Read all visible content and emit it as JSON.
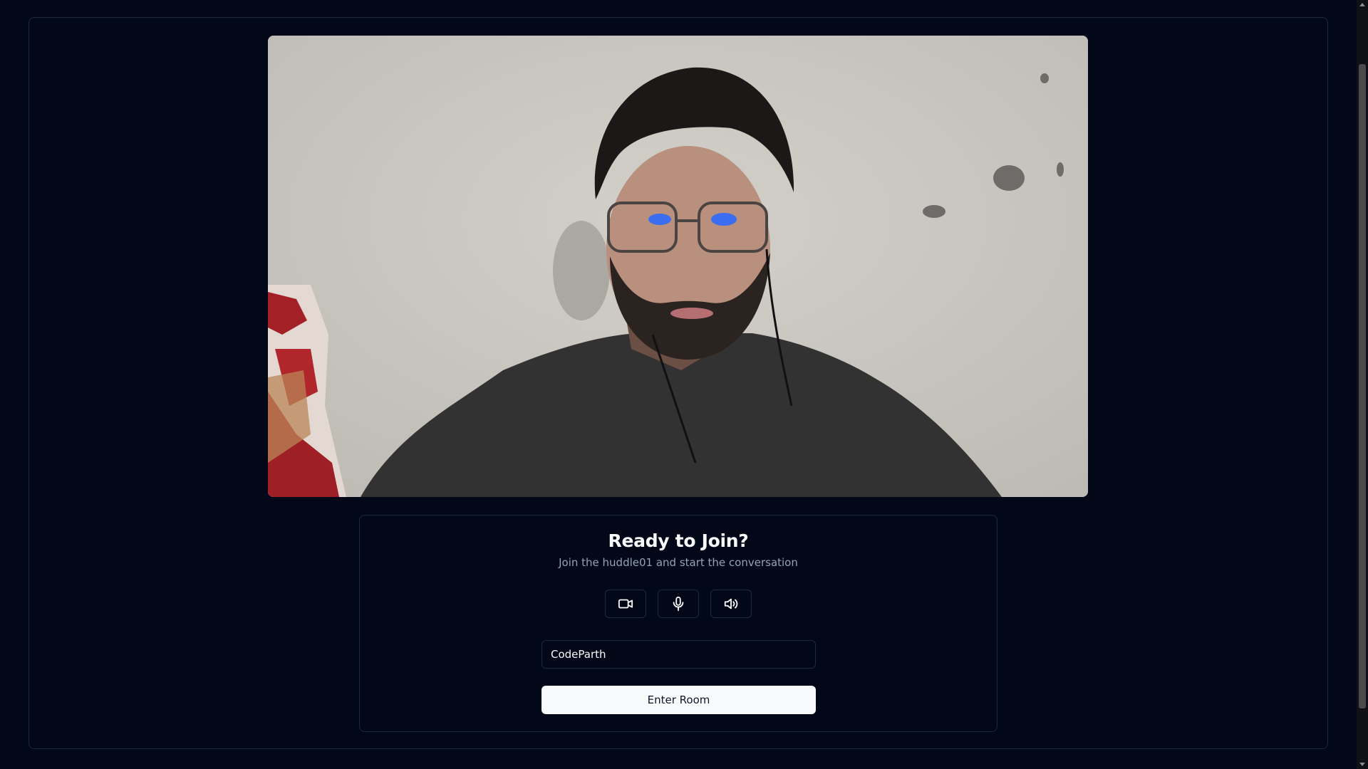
{
  "join": {
    "title": "Ready to Join?",
    "subtitle": "Join the huddle01 and start the conversation",
    "name_value": "CodeParth",
    "enter_label": "Enter Room"
  },
  "controls": [
    {
      "icon": "video-camera-icon"
    },
    {
      "icon": "microphone-icon"
    },
    {
      "icon": "speaker-icon"
    }
  ],
  "colors": {
    "background": "#020817",
    "border": "#1e293b",
    "button_bg": "#f8fafc",
    "muted_text": "#94a3b8"
  }
}
